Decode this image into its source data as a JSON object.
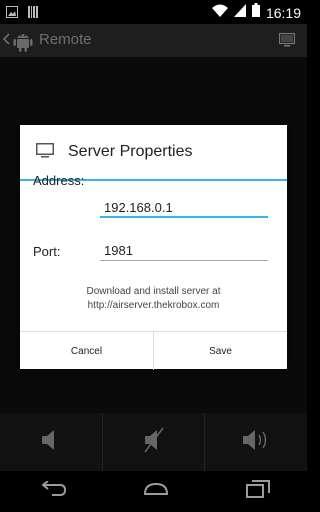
{
  "status_bar": {
    "time": "16:19",
    "icons": [
      "image-icon",
      "barcode-icon",
      "wifi-icon",
      "signal-icon",
      "battery-icon"
    ]
  },
  "action_bar": {
    "title": "Remote",
    "icons": [
      "up-chevron-icon",
      "android-logo-icon",
      "monitor-icon"
    ]
  },
  "dialog": {
    "title": "Server Properties",
    "title_icon": "monitor-icon",
    "address_label": "Address:",
    "address_value": "192.168.0.1",
    "port_label": "Port:",
    "port_value": "1981",
    "info_line1": "Download and install server at",
    "info_line2": "http://airserver.thekrobox.com",
    "cancel_label": "Cancel",
    "save_label": "Save"
  },
  "volume_controls": [
    "volume-down-icon",
    "mute-icon",
    "volume-up-icon"
  ],
  "nav_bar": [
    "back-icon",
    "home-icon",
    "recents-icon"
  ],
  "colors": {
    "accent": "#33b5e5",
    "action_bar": "#1e1e1e",
    "dialog_background": "#ffffff"
  }
}
